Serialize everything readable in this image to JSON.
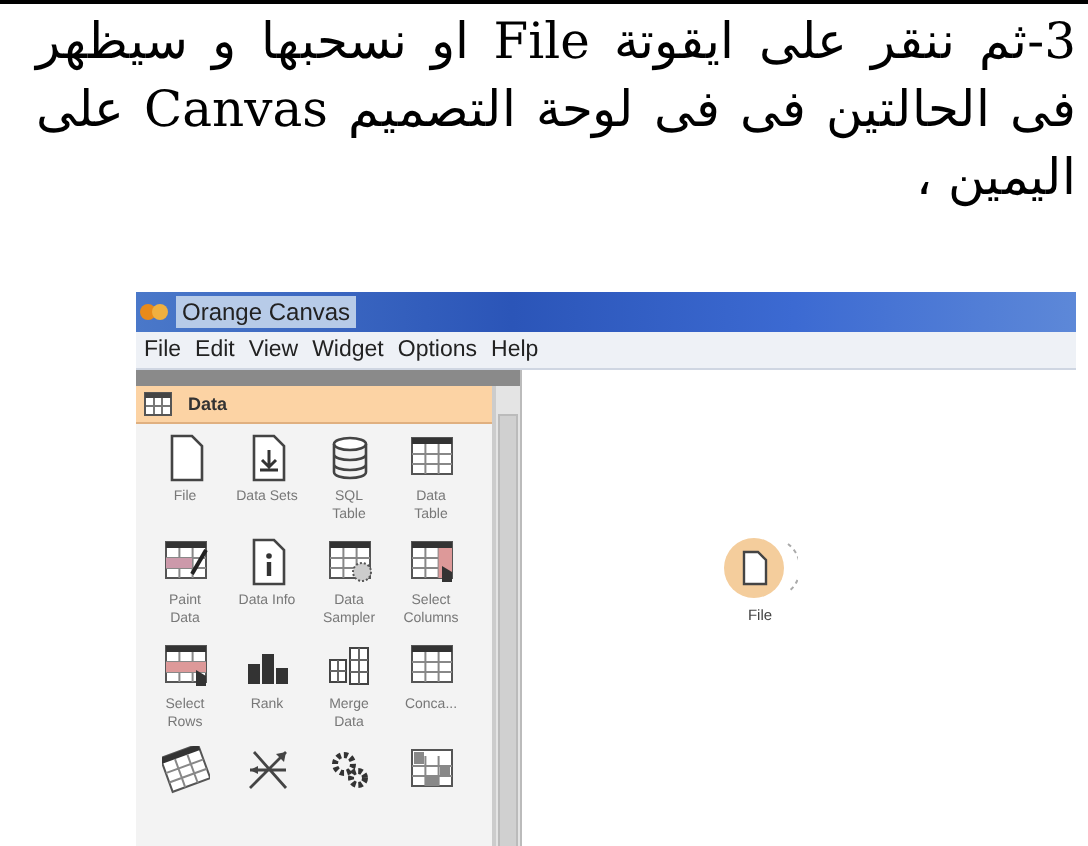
{
  "paragraph": "3-ثم ننقر على ايقوتة File او نسحبها و سيظهر فى الحالتين فى فى لوحة التصميم Canvas على اليمين ،",
  "window": {
    "title": "Orange Canvas",
    "menu": [
      "File",
      "Edit",
      "View",
      "Widget",
      "Options",
      "Help"
    ]
  },
  "category": {
    "label": "Data"
  },
  "widgets": [
    {
      "label": "File",
      "kind": "file"
    },
    {
      "label": "Data Sets",
      "kind": "download"
    },
    {
      "label": "SQL Table",
      "kind": "database"
    },
    {
      "label": "Data Table",
      "kind": "table"
    },
    {
      "label": "Paint Data",
      "kind": "brush"
    },
    {
      "label": "Data Info",
      "kind": "info"
    },
    {
      "label": "Data Sampler",
      "kind": "dots"
    },
    {
      "label": "Select Columns",
      "kind": "cursor"
    },
    {
      "label": "Select Rows",
      "kind": "hand"
    },
    {
      "label": "Rank",
      "kind": "podium"
    },
    {
      "label": "Merge Data",
      "kind": "merge"
    },
    {
      "label": "Conca...",
      "kind": "concat"
    },
    {
      "kind": "rotate"
    },
    {
      "kind": "cross"
    },
    {
      "kind": "gears"
    },
    {
      "kind": "squares"
    }
  ],
  "canvas_node": {
    "label": "File"
  }
}
